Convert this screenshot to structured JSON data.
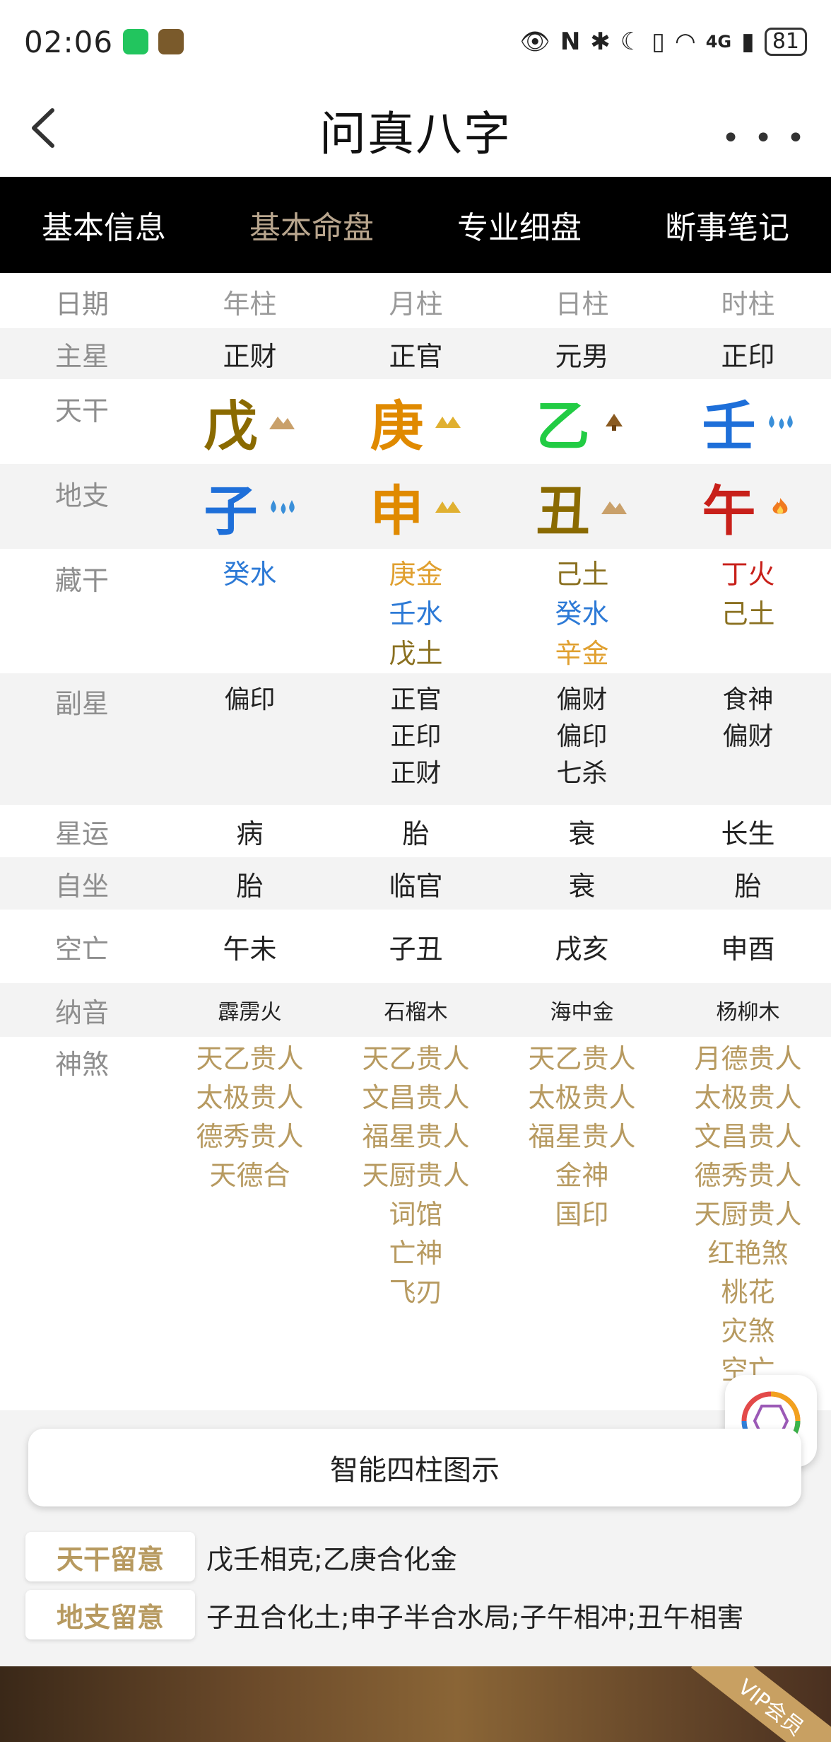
{
  "status": {
    "time": "02:06",
    "battery": "81",
    "network": "4G"
  },
  "header": {
    "title": "问真八字"
  },
  "tabs": [
    {
      "label": "基本信息"
    },
    {
      "label": "基本命盘"
    },
    {
      "label": "专业细盘"
    },
    {
      "label": "断事笔记"
    }
  ],
  "table": {
    "headers": {
      "label": "日期",
      "cols": [
        "年柱",
        "月柱",
        "日柱",
        "时柱"
      ]
    },
    "main_star": {
      "label": "主星",
      "values": [
        "正财",
        "正官",
        "元男",
        "正印"
      ]
    },
    "tiangan": {
      "label": "天干",
      "values": [
        "戊",
        "庚",
        "乙",
        "壬"
      ],
      "colors": [
        "#8a6a00",
        "#e08a00",
        "#22cc44",
        "#1e6fd9"
      ],
      "symbols": [
        "mountain",
        "gold",
        "wood",
        "water"
      ]
    },
    "dizhi": {
      "label": "地支",
      "values": [
        "子",
        "申",
        "丑",
        "午"
      ],
      "colors": [
        "#1e6fd9",
        "#e08a00",
        "#8a6a00",
        "#c8201a"
      ],
      "symbols": [
        "water",
        "gold",
        "mountain",
        "fire"
      ]
    },
    "canggan": {
      "label": "藏干",
      "cols": [
        [
          {
            "text": "癸水",
            "color": "#2d7ad6"
          }
        ],
        [
          {
            "text": "庚金",
            "color": "#e0a030"
          },
          {
            "text": "壬水",
            "color": "#2d7ad6"
          },
          {
            "text": "戊土",
            "color": "#8a7020"
          }
        ],
        [
          {
            "text": "己土",
            "color": "#8a7020"
          },
          {
            "text": "癸水",
            "color": "#2d7ad6"
          },
          {
            "text": "辛金",
            "color": "#e0a030"
          }
        ],
        [
          {
            "text": "丁火",
            "color": "#c8201a"
          },
          {
            "text": "己土",
            "color": "#8a7020"
          }
        ]
      ]
    },
    "fuxing": {
      "label": "副星",
      "cols": [
        [
          "偏印"
        ],
        [
          "正官",
          "正印",
          "正财"
        ],
        [
          "偏财",
          "偏印",
          "七杀"
        ],
        [
          "食神",
          "偏财"
        ]
      ]
    },
    "xingyun": {
      "label": "星运",
      "values": [
        "病",
        "胎",
        "衰",
        "长生"
      ]
    },
    "zizuo": {
      "label": "自坐",
      "values": [
        "胎",
        "临官",
        "衰",
        "胎"
      ]
    },
    "kongwang": {
      "label": "空亡",
      "values": [
        "午未",
        "子丑",
        "戌亥",
        "申酉"
      ]
    },
    "nayin": {
      "label": "纳音",
      "values": [
        "霹雳火",
        "石榴木",
        "海中金",
        "杨柳木"
      ]
    },
    "shensha": {
      "label": "神煞",
      "cols": [
        [
          "天乙贵人",
          "太极贵人",
          "德秀贵人",
          "天德合"
        ],
        [
          "天乙贵人",
          "文昌贵人",
          "福星贵人",
          "天厨贵人",
          "词馆",
          "亡神",
          "飞刃"
        ],
        [
          "天乙贵人",
          "太极贵人",
          "福星贵人",
          "金神",
          "国印"
        ],
        [
          "月德贵人",
          "太极贵人",
          "文昌贵人",
          "德秀贵人",
          "天厨贵人",
          "红艳煞",
          "桃花",
          "灾煞",
          "空亡"
        ]
      ]
    }
  },
  "diagram_button": "智能四柱图示",
  "notes": [
    {
      "tag": "天干留意",
      "text": "戊壬相克;乙庚合化金"
    },
    {
      "tag": "地支留意",
      "text": "子丑合化土;申子半合水局;子午相冲;丑午相害"
    }
  ],
  "banner": {
    "vip": "VIP会员"
  }
}
